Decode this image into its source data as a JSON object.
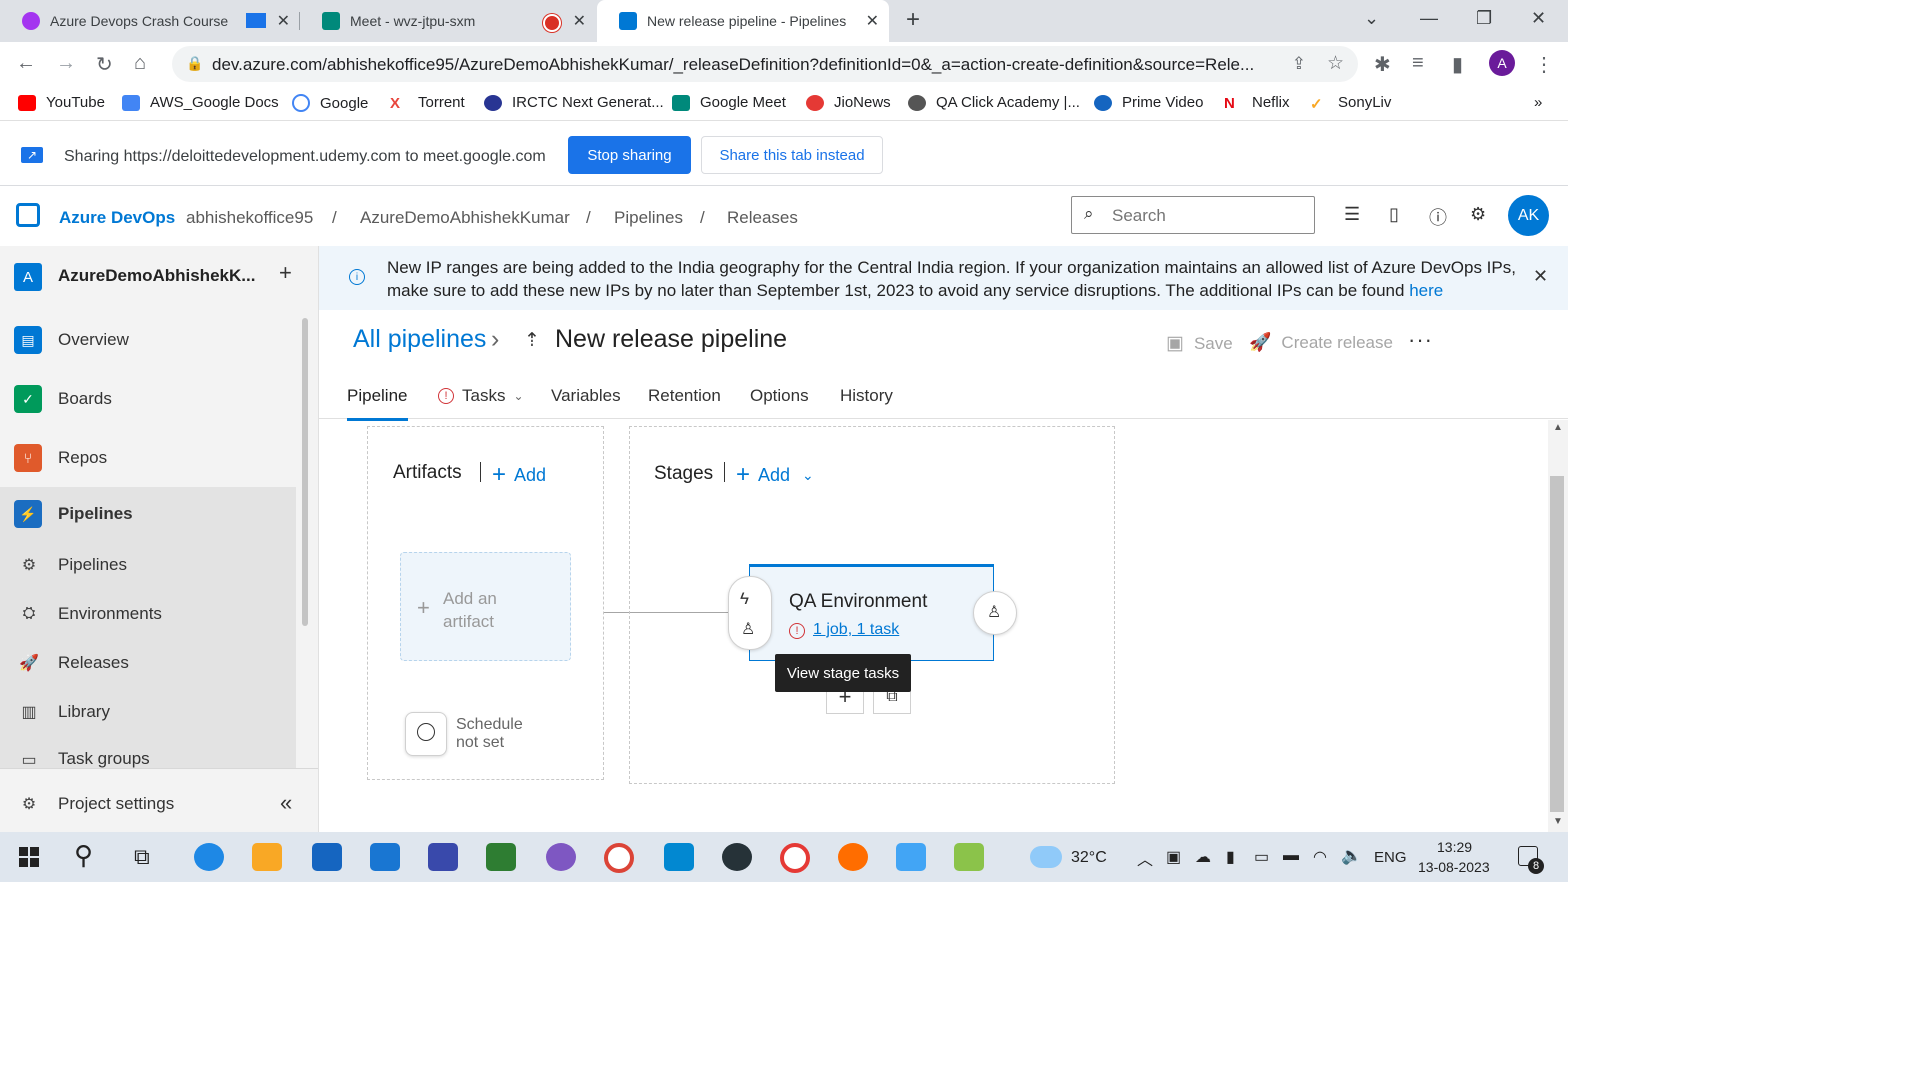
{
  "browser": {
    "tabs": [
      {
        "title": "Azure Devops Crash Course"
      },
      {
        "title": "Meet - wvz-jtpu-sxm"
      },
      {
        "title": "New release pipeline - Pipelines"
      }
    ],
    "url": "dev.azure.com/abhishekoffice95/AzureDemoAbhishekKumar/_releaseDefinition?definitionId=0&_a=action-create-definition&source=Rele...",
    "profile_initial": "A",
    "bookmarks": [
      "YouTube",
      "AWS_Google Docs",
      "Google",
      "Torrent",
      "IRCTC Next Generat...",
      "Google Meet",
      "JioNews",
      "QA Click Academy |...",
      "Prime Video",
      "Neflix",
      "SonyLiv"
    ],
    "more": "»"
  },
  "sharebar": {
    "text": "Sharing https://deloittedevelopment.udemy.com to meet.google.com",
    "stop_label": "Stop sharing",
    "share_tab_label": "Share this tab instead"
  },
  "ado_header": {
    "brand": "Azure DevOps",
    "breadcrumb": [
      "abhishekoffice95",
      "AzureDemoAbhishekKumar",
      "Pipelines",
      "Releases"
    ],
    "separator": "/",
    "search_placeholder": "Search",
    "avatar": "AK"
  },
  "sidebar": {
    "project_initial": "A",
    "project_name": "AzureDemoAbhishekK...",
    "add": "+",
    "items": [
      {
        "label": "Overview"
      },
      {
        "label": "Boards"
      },
      {
        "label": "Repos"
      },
      {
        "label": "Pipelines"
      }
    ],
    "subitems": [
      {
        "label": "Pipelines"
      },
      {
        "label": "Environments"
      },
      {
        "label": "Releases"
      },
      {
        "label": "Library"
      },
      {
        "label": "Task groups"
      }
    ],
    "project_settings": "Project settings",
    "collapse": "«"
  },
  "banner": {
    "text": "New IP ranges are being added to the India geography for the Central India region. If your organization maintains an allowed list of Azure DevOps IPs, make sure to add these new IPs by no later than September 1st, 2023 to avoid any service disruptions. The additional IPs can be found",
    "link": "here"
  },
  "page": {
    "all_pipelines": "All pipelines",
    "chevron": "›",
    "title": "New release pipeline",
    "save": "Save",
    "create_release": "Create release",
    "more": "···"
  },
  "tabs": [
    "Pipeline",
    "Tasks",
    "Variables",
    "Retention",
    "Options",
    "History"
  ],
  "canvas": {
    "artifacts_title": "Artifacts",
    "stages_title": "Stages",
    "add": "Add",
    "add_artifact": "Add an artifact",
    "schedule": "Schedule not set",
    "stage_name": "QA Environment",
    "stage_tasks": "1 job, 1 task",
    "tooltip": "View stage tasks"
  },
  "taskbar": {
    "weather": "32°C",
    "lang": "ENG",
    "time": "13:29",
    "date": "13-08-2023",
    "badge": "8"
  }
}
